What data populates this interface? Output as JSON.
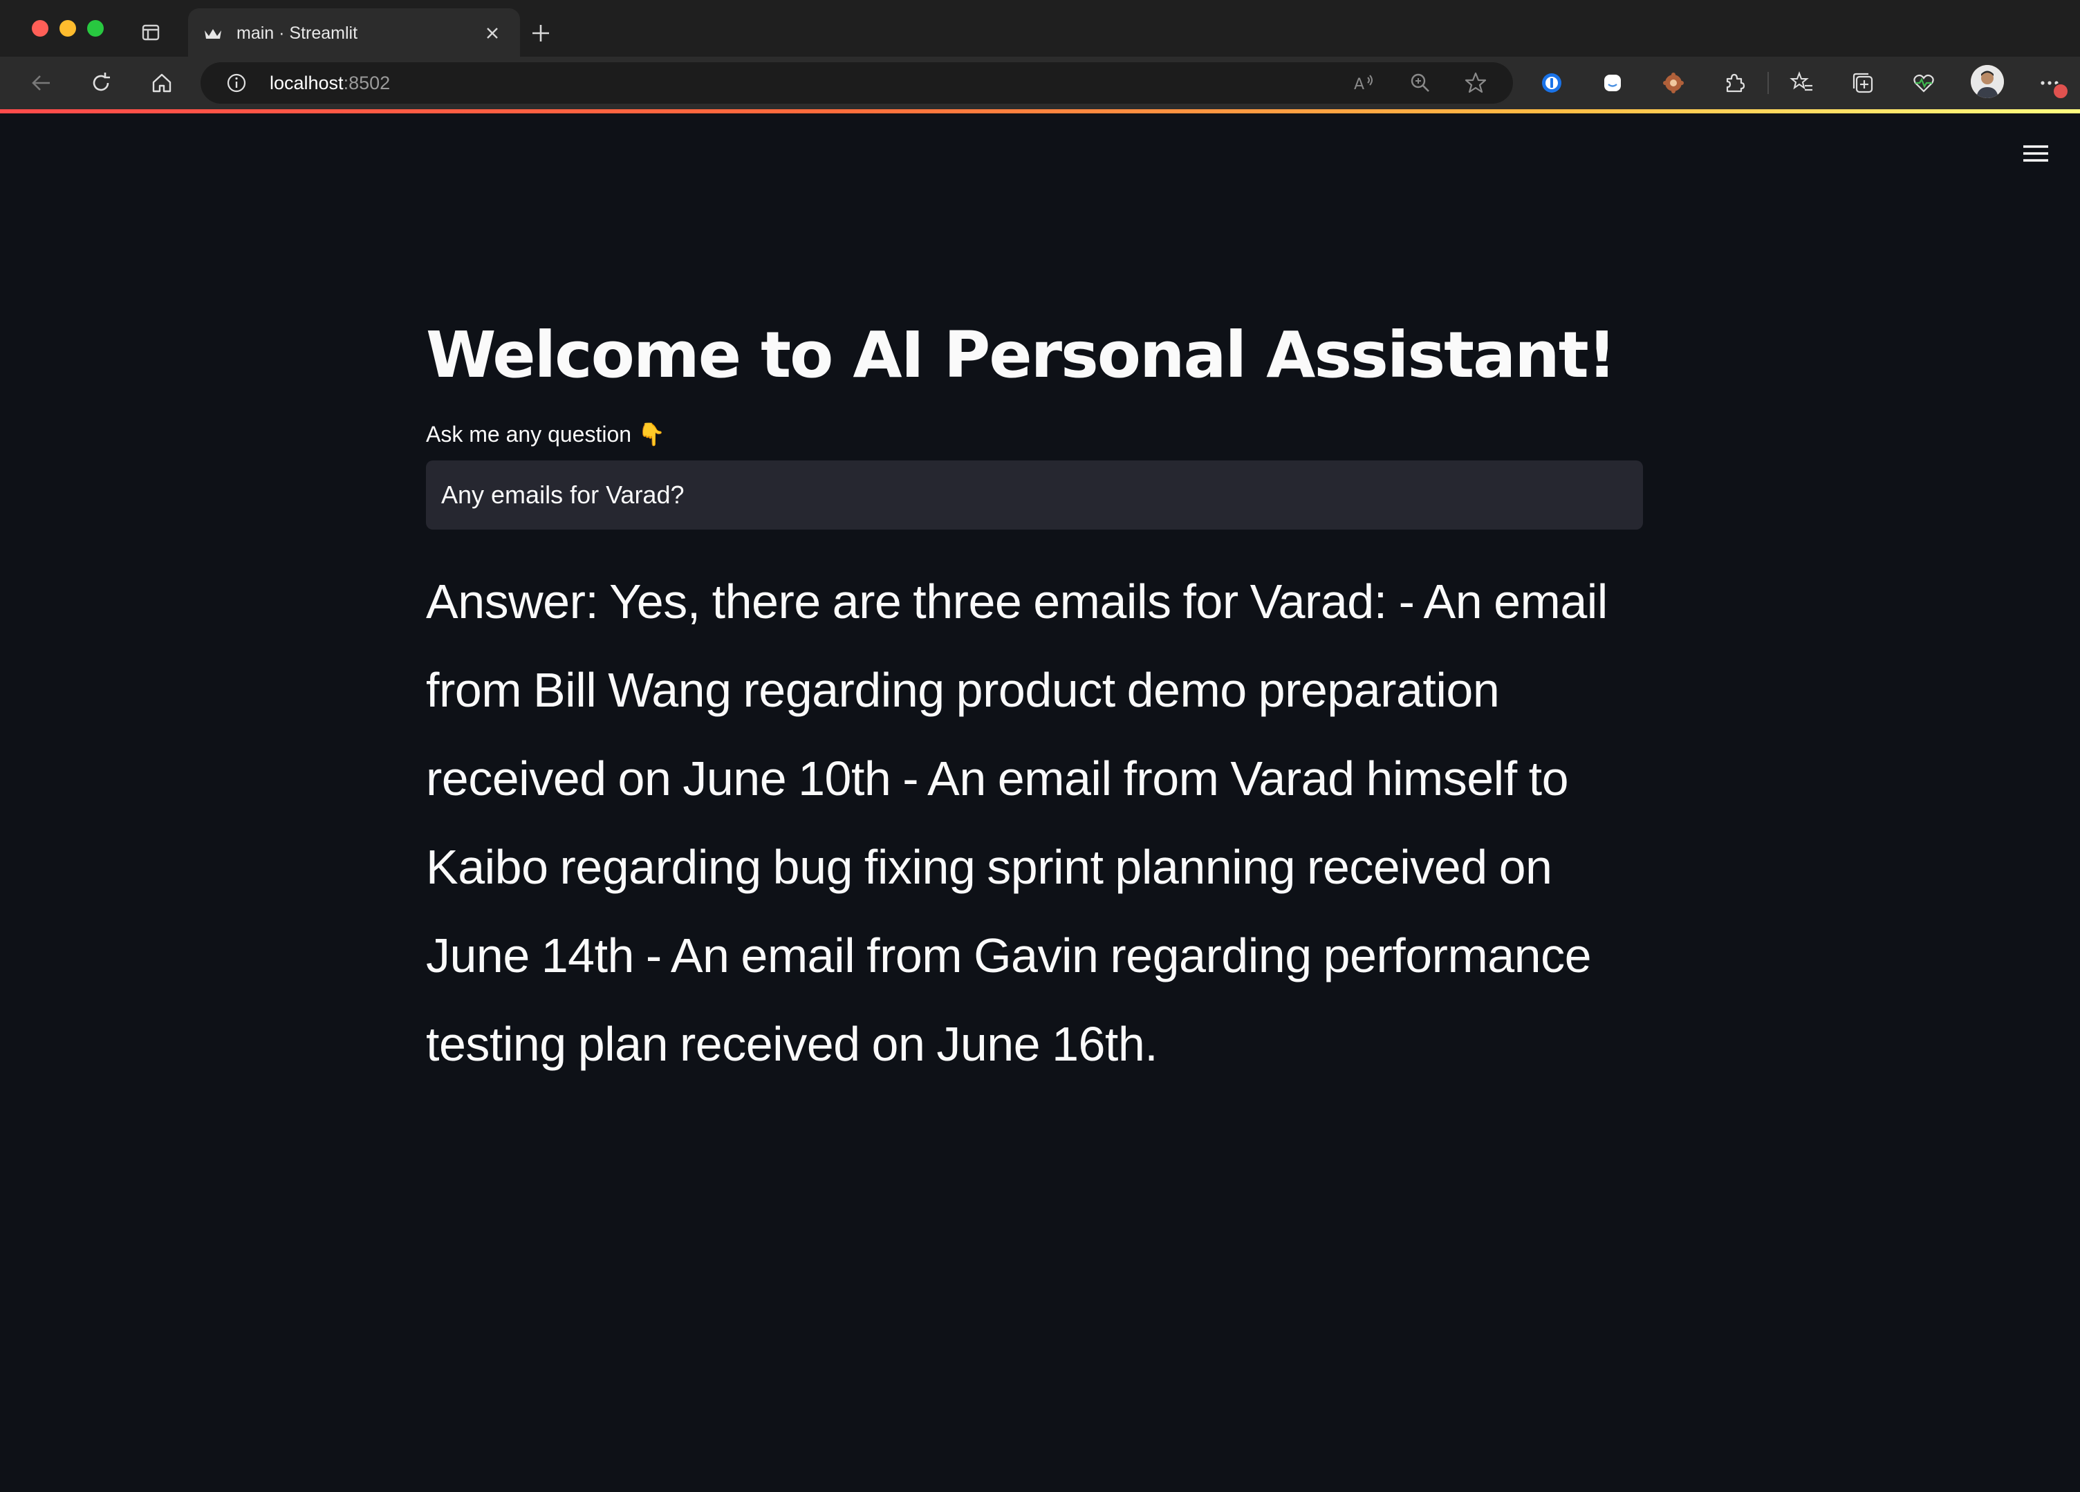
{
  "browser": {
    "tab": {
      "title": "main · Streamlit"
    },
    "address_bar": {
      "host": "localhost",
      "port": ":8502"
    },
    "icons": {
      "back": "back-arrow-icon",
      "reload": "reload-icon",
      "home": "home-icon",
      "read_aloud": "read-aloud-icon",
      "zoom": "zoom-icon",
      "favorite": "star-icon",
      "extensions": [
        "password-manager-icon",
        "chat-extension-icon",
        "settings-extension-icon",
        "puzzle-icon"
      ],
      "favorites": "favorites-icon",
      "collections": "collections-icon",
      "health": "browser-essentials-icon",
      "more": "more-icon"
    },
    "accent_colors": {
      "loading_bar_start": "#ff4b4b",
      "loading_bar_end": "#fffd80"
    }
  },
  "app": {
    "title": "Welcome to AI Personal Assistant!",
    "input": {
      "label": "Ask me any question",
      "label_emoji": "👇",
      "value": "Any emails for Varad?"
    },
    "answer": "Answer: Yes, there are three emails for Varad: - An email from Bill Wang regarding product demo preparation received on June 10th - An email from Varad himself to Kaibo regarding bug fixing sprint planning received on June 14th - An email from Gavin regarding performance testing plan received on June 16th.",
    "background_color": "#0e1117",
    "input_background": "#262730"
  }
}
